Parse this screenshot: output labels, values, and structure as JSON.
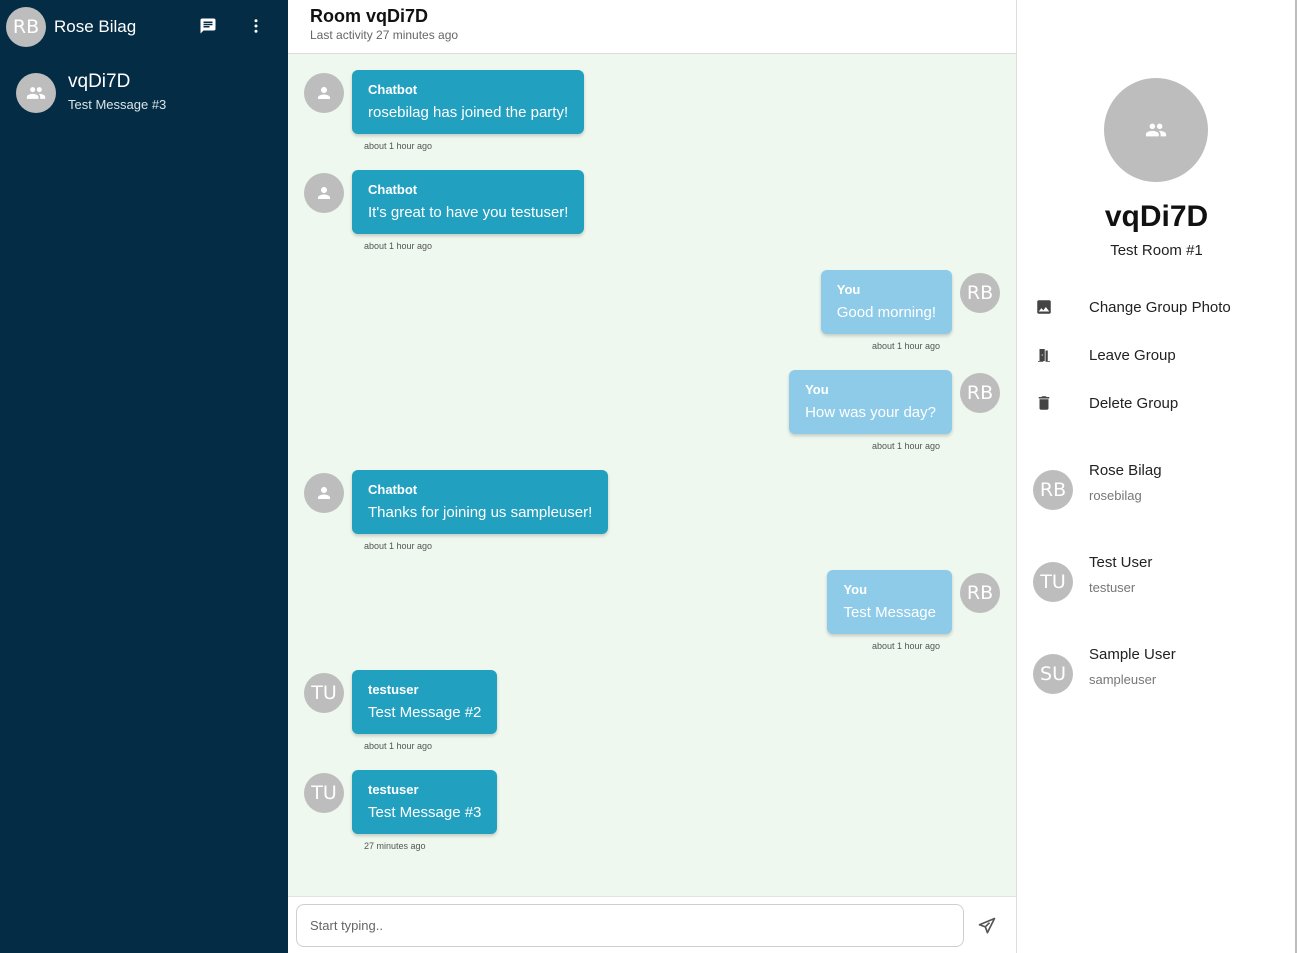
{
  "sidebar": {
    "current_user": {
      "initials": "RB",
      "name": "Rose Bilag"
    },
    "icons": {
      "new_chat": "chat-icon",
      "menu": "more-vertical-icon"
    },
    "rooms": [
      {
        "name": "vqDi7D",
        "last_message": "Test Message #3",
        "icon": "group-icon"
      }
    ]
  },
  "room": {
    "title": "Room vqDi7D",
    "last_activity": "Last activity 27 minutes ago"
  },
  "messages": [
    {
      "sender": "Chatbot",
      "text": "rosebilag has joined the party!",
      "time": "about 1 hour ago",
      "mine": false,
      "avatar": "person-icon"
    },
    {
      "sender": "Chatbot",
      "text": "It's great to have you testuser!",
      "time": "about 1 hour ago",
      "mine": false,
      "avatar": "person-icon"
    },
    {
      "sender": "You",
      "text": "Good morning!",
      "time": "about 1 hour ago",
      "mine": true,
      "avatar": "RB"
    },
    {
      "sender": "You",
      "text": "How was your day?",
      "time": "about 1 hour ago",
      "mine": true,
      "avatar": "RB"
    },
    {
      "sender": "Chatbot",
      "text": "Thanks for joining us sampleuser!",
      "time": "about 1 hour ago",
      "mine": false,
      "avatar": "person-icon"
    },
    {
      "sender": "You",
      "text": "Test Message",
      "time": "about 1 hour ago",
      "mine": true,
      "avatar": "RB"
    },
    {
      "sender": "testuser",
      "text": "Test Message #2",
      "time": "about 1 hour ago",
      "mine": false,
      "avatar": "TU"
    },
    {
      "sender": "testuser",
      "text": "Test Message #3",
      "time": "27 minutes ago",
      "mine": false,
      "avatar": "TU"
    }
  ],
  "composer": {
    "placeholder": "Start typing..",
    "send_icon": "send-icon"
  },
  "details": {
    "room_name": "vqDi7D",
    "room_description": "Test Room #1",
    "actions": [
      {
        "label": "Change Group Photo",
        "icon": "image-icon"
      },
      {
        "label": "Leave Group",
        "icon": "exit-door-icon"
      },
      {
        "label": "Delete Group",
        "icon": "trash-icon"
      }
    ],
    "members": [
      {
        "initials": "RB",
        "name": "Rose Bilag",
        "username": "rosebilag"
      },
      {
        "initials": "TU",
        "name": "Test User",
        "username": "testuser"
      },
      {
        "initials": "SU",
        "name": "Sample User",
        "username": "sampleuser"
      }
    ]
  },
  "colors": {
    "sidebar_bg": "#042c44",
    "chat_bg": "#eef8ee",
    "bubble_other": "#22a0c0",
    "bubble_mine": "#8ecbe8",
    "avatar_grey": "#bdbdbd"
  }
}
